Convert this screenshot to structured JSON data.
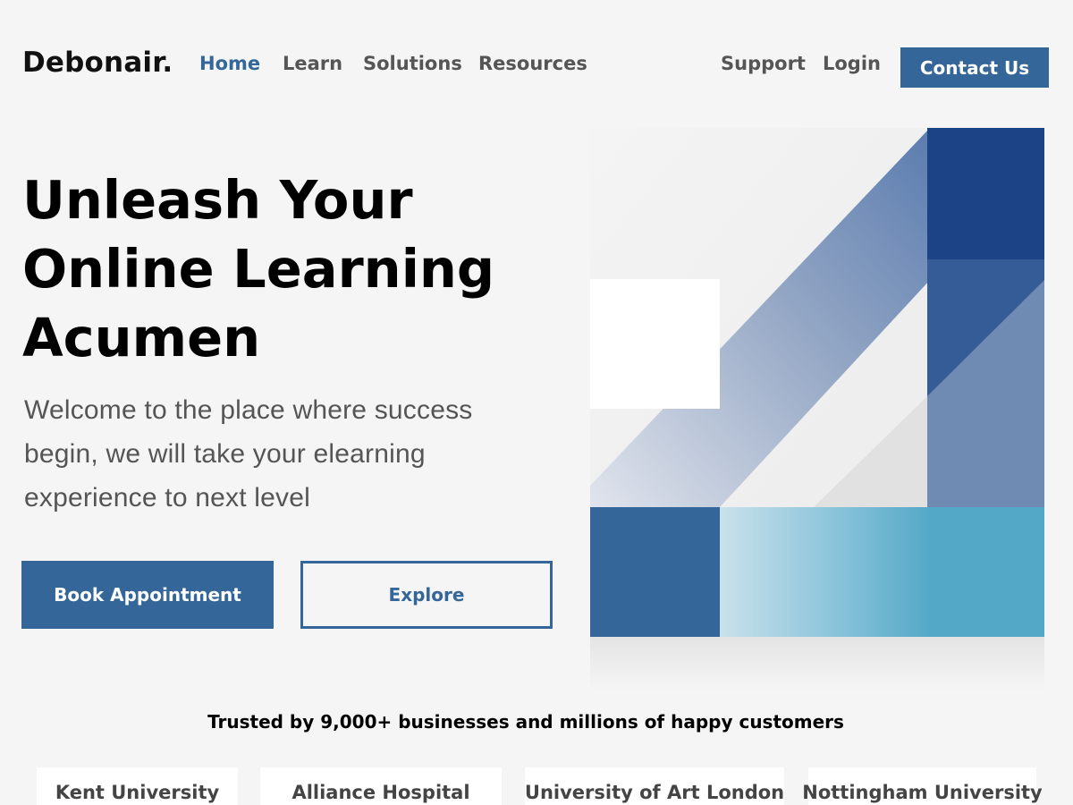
{
  "header": {
    "logo": "Debonair.",
    "nav": {
      "home": "Home",
      "learn": "Learn",
      "solutions": "Solutions",
      "resources": "Resources",
      "support": "Support",
      "login": "Login"
    },
    "contact_label": "Contact Us"
  },
  "hero": {
    "title_line1": "Unleash Your",
    "title_line2": "Online Learning",
    "title_line3": "Acumen",
    "subtitle_line1": "Welcome to the place where success",
    "subtitle_line2": "begin, we will take your elearning",
    "subtitle_line3": "experience to next level",
    "primary_label": "Book Appointment",
    "secondary_label": "Explore"
  },
  "trusted": {
    "headline": "Trusted by 9,000+ businesses and millions of happy customers",
    "partners": [
      "Kent University",
      "Alliance Hospital",
      "University of Art London",
      "Nottingham University"
    ]
  },
  "colors": {
    "accent": "#346699",
    "dark_blue": "#1b4386",
    "light_blue": "#53a8c8",
    "background": "#f5f5f5"
  }
}
